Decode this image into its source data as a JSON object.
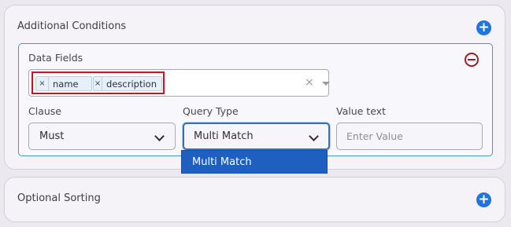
{
  "additional": {
    "title": "Additional Conditions",
    "add_icon": "plus-circle-icon"
  },
  "condition": {
    "data_fields_label": "Data Fields",
    "remove_icon": "minus-circle-icon",
    "chips": [
      {
        "label": "name",
        "remove": "×"
      },
      {
        "label": "description",
        "remove": "×"
      }
    ],
    "clear_all": "×",
    "clause_label": "Clause",
    "clause_value": "Must",
    "query_type_label": "Query Type",
    "query_type_value": "Multi Match",
    "value_text_label": "Value text",
    "value_placeholder": "Enter Value"
  },
  "dropdown": {
    "options": [
      "Multi Match"
    ]
  },
  "optional": {
    "title": "Optional Sorting",
    "add_icon": "plus-circle-icon"
  },
  "colors": {
    "accent": "#1f74e0",
    "highlight_border": "#d1121d",
    "remove": "#a21c26",
    "dropdown_selected": "#1f5fc0"
  }
}
